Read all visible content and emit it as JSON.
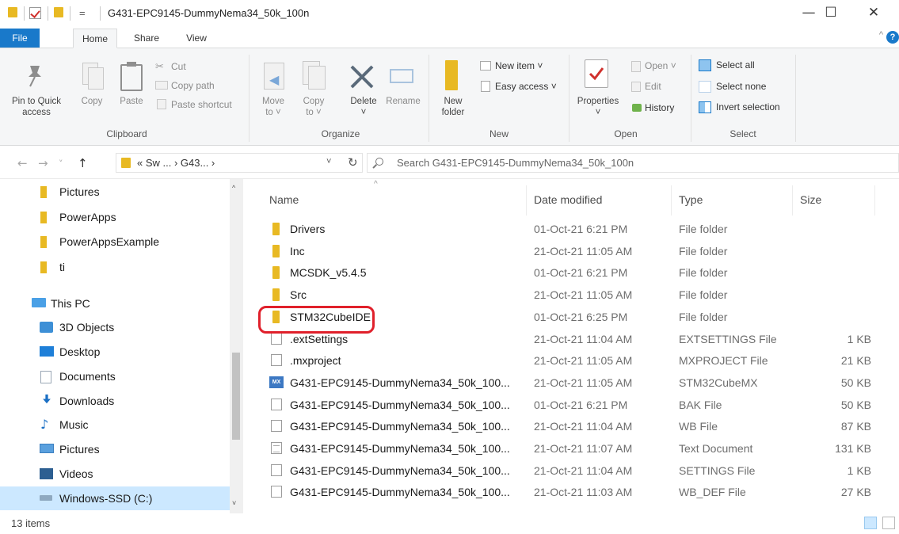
{
  "window": {
    "title": "G431-EPC9145-DummyNema34_50k_100n",
    "quick_access_sep": "=",
    "minimize": "—",
    "maximize": "☐",
    "close": "✕"
  },
  "tabs": {
    "file": "File",
    "home": "Home",
    "share": "Share",
    "view": "View",
    "collapse": "^",
    "help": "?"
  },
  "ribbon": {
    "clipboard": {
      "label": "Clipboard",
      "pin_line1": "Pin to Quick",
      "pin_line2": "access",
      "copy": "Copy",
      "paste": "Paste",
      "cut": "Cut",
      "copy_path": "Copy path",
      "paste_shortcut": "Paste shortcut"
    },
    "organize": {
      "label": "Organize",
      "move_line1": "Move",
      "move_line2": "to ˅",
      "copy_line1": "Copy",
      "copy_line2": "to ˅",
      "delete_line1": "Delete",
      "delete_line2": "˅",
      "rename": "Rename"
    },
    "new": {
      "label": "New",
      "folder_line1": "New",
      "folder_line2": "folder",
      "new_item": "New item ˅",
      "easy_access": "Easy access ˅"
    },
    "open": {
      "label": "Open",
      "properties": "Properties",
      "properties_dd": "˅",
      "open": "Open ˅",
      "edit": "Edit",
      "history": "History"
    },
    "select": {
      "label": "Select",
      "select_all": "Select all",
      "select_none": "Select none",
      "invert": "Invert selection"
    }
  },
  "address": {
    "path": "« Sw ... › G43... ›",
    "dropdown": "˅",
    "refresh": "↻",
    "back": "←",
    "forward": "→",
    "recent": "˅",
    "up": "↑",
    "search_placeholder": "Search G431-EPC9145-DummyNema34_50k_100n"
  },
  "nav": {
    "items": [
      {
        "label": "Pictures"
      },
      {
        "label": "PowerApps"
      },
      {
        "label": "PowerAppsExample"
      },
      {
        "label": "ti"
      },
      {
        "label": "This PC"
      },
      {
        "label": "3D Objects"
      },
      {
        "label": "Desktop"
      },
      {
        "label": "Documents"
      },
      {
        "label": "Downloads"
      },
      {
        "label": "Music"
      },
      {
        "label": "Pictures"
      },
      {
        "label": "Videos"
      },
      {
        "label": "Windows-SSD (C:)"
      }
    ],
    "scroll_up": "^",
    "scroll_down": "˅"
  },
  "columns": {
    "name": "Name",
    "date": "Date modified",
    "type": "Type",
    "size": "Size",
    "sort": "^"
  },
  "files": [
    {
      "name": "Drivers",
      "date": "01-Oct-21 6:21 PM",
      "type": "File folder",
      "size": "",
      "icon": "folder-icon"
    },
    {
      "name": "Inc",
      "date": "21-Oct-21 11:05 AM",
      "type": "File folder",
      "size": "",
      "icon": "folder-icon"
    },
    {
      "name": "MCSDK_v5.4.5",
      "date": "01-Oct-21 6:21 PM",
      "type": "File folder",
      "size": "",
      "icon": "folder-icon"
    },
    {
      "name": "Src",
      "date": "21-Oct-21 11:05 AM",
      "type": "File folder",
      "size": "",
      "icon": "folder-icon"
    },
    {
      "name": "STM32CubeIDE",
      "date": "01-Oct-21 6:25 PM",
      "type": "File folder",
      "size": "",
      "icon": "folder-icon"
    },
    {
      "name": ".extSettings",
      "date": "21-Oct-21 11:04 AM",
      "type": "EXTSETTINGS File",
      "size": "1 KB",
      "icon": "file-icon"
    },
    {
      "name": ".mxproject",
      "date": "21-Oct-21 11:05 AM",
      "type": "MXPROJECT File",
      "size": "21 KB",
      "icon": "file-icon"
    },
    {
      "name": "G431-EPC9145-DummyNema34_50k_100...",
      "date": "21-Oct-21 11:05 AM",
      "type": "STM32CubeMX",
      "size": "50 KB",
      "icon": "mx-icon",
      "icon_text": "MX"
    },
    {
      "name": "G431-EPC9145-DummyNema34_50k_100...",
      "date": "01-Oct-21 6:21 PM",
      "type": "BAK File",
      "size": "50 KB",
      "icon": "file-icon"
    },
    {
      "name": "G431-EPC9145-DummyNema34_50k_100...",
      "date": "21-Oct-21 11:04 AM",
      "type": "WB File",
      "size": "87 KB",
      "icon": "file-icon"
    },
    {
      "name": "G431-EPC9145-DummyNema34_50k_100...",
      "date": "21-Oct-21 11:07 AM",
      "type": "Text Document",
      "size": "131 KB",
      "icon": "text-file-icon"
    },
    {
      "name": "G431-EPC9145-DummyNema34_50k_100...",
      "date": "21-Oct-21 11:04 AM",
      "type": "SETTINGS File",
      "size": "1 KB",
      "icon": "file-icon"
    },
    {
      "name": "G431-EPC9145-DummyNema34_50k_100...",
      "date": "21-Oct-21 11:03 AM",
      "type": "WB_DEF File",
      "size": "27 KB",
      "icon": "file-icon"
    }
  ],
  "status": {
    "count": "13 items"
  },
  "colors": {
    "accent": "#1979ca",
    "folder": "#e8b923",
    "highlight": "#e0202b",
    "selection": "#cce8ff"
  }
}
